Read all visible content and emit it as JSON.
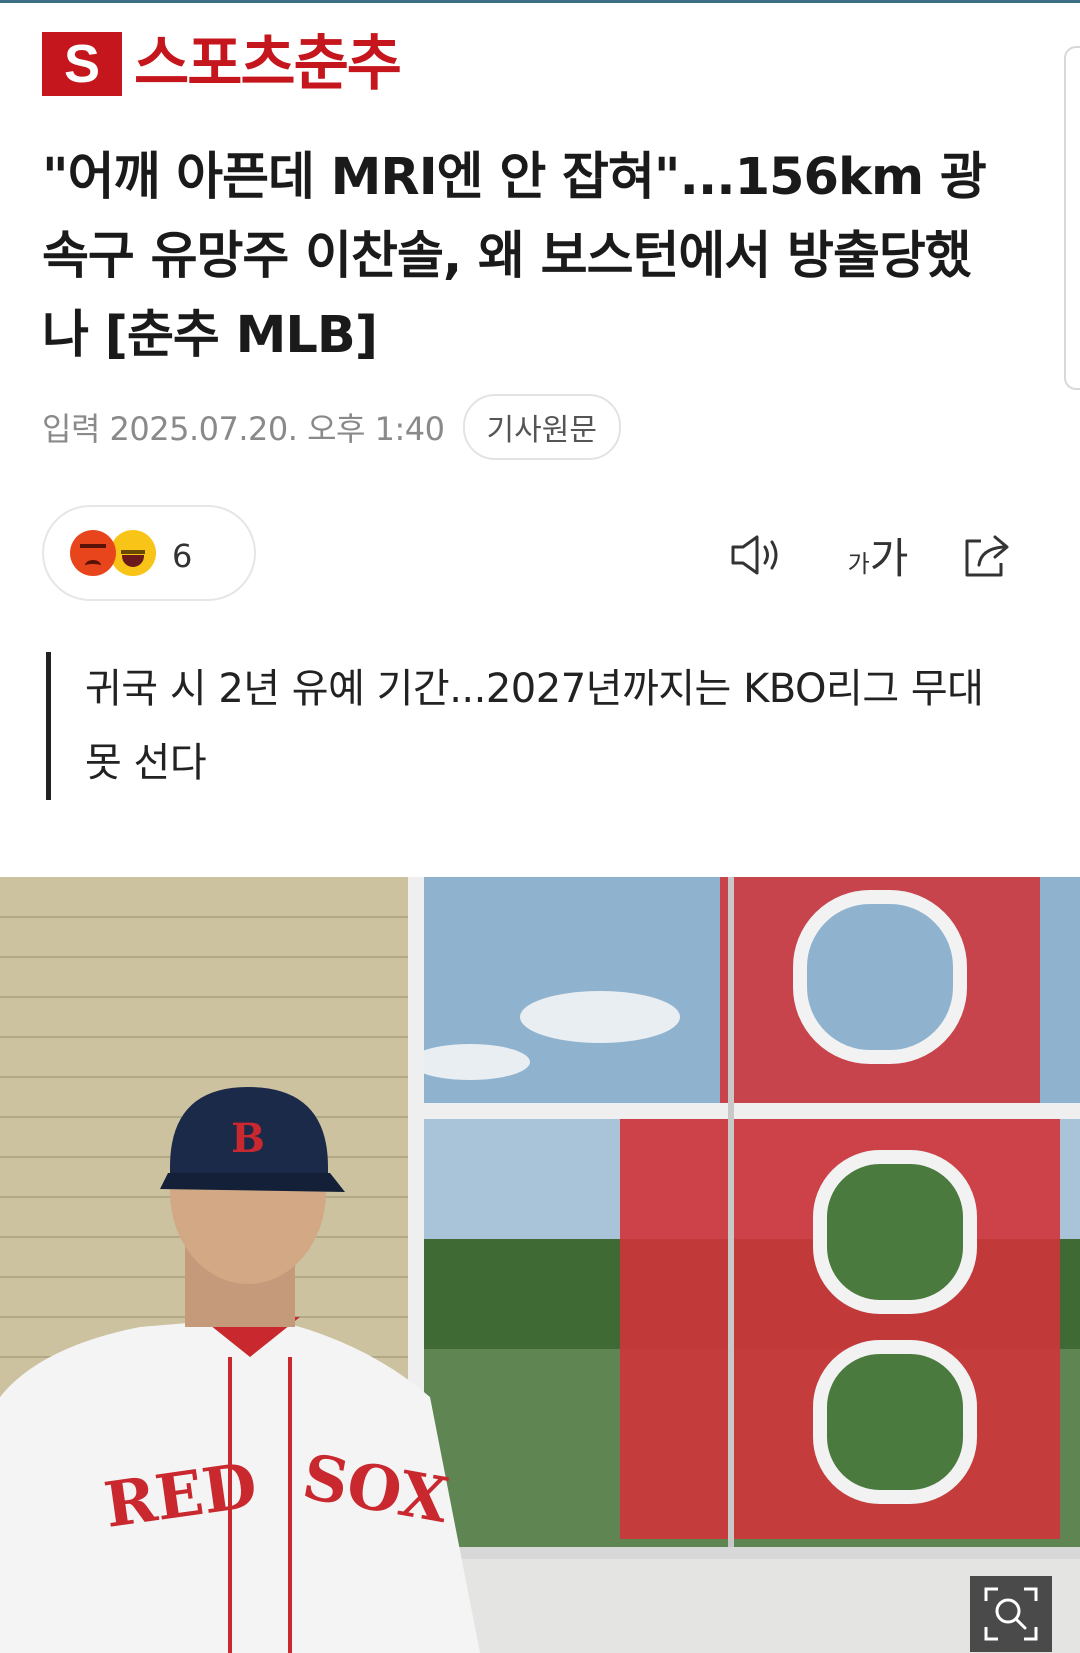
{
  "app": {
    "logo_mark": "S",
    "logo_text": "스포츠춘추"
  },
  "article": {
    "title": "\"어깨 아픈데 MRI엔 안 잡혀\"...156km 광속구 유망주 이찬솔, 왜 보스턴에서 방출당했나 [춘추 MLB]",
    "published": "입력 2025.07.20. 오후 1:40",
    "original_link_label": "기사원문",
    "subtitle": "귀국 시 2년 유예 기간...2027년까지는 KBO리그 무대 못 선다"
  },
  "reactions": {
    "count": "6",
    "emojis": [
      "angry-face-icon",
      "laughing-face-icon"
    ]
  },
  "toolbar": {
    "speaker_icon": "speaker-icon",
    "font_size_small": "가",
    "font_size_big": "가",
    "share_icon": "share-icon"
  },
  "photo": {
    "cap_letter": "B",
    "jersey_text_left": "RED",
    "jersey_text_right": "SOX",
    "zoom_icon": "zoom-search-icon"
  },
  "colors": {
    "brand_red": "#c4161c",
    "top_line": "#3c6e86",
    "meta_gray": "#8a8a8a"
  }
}
